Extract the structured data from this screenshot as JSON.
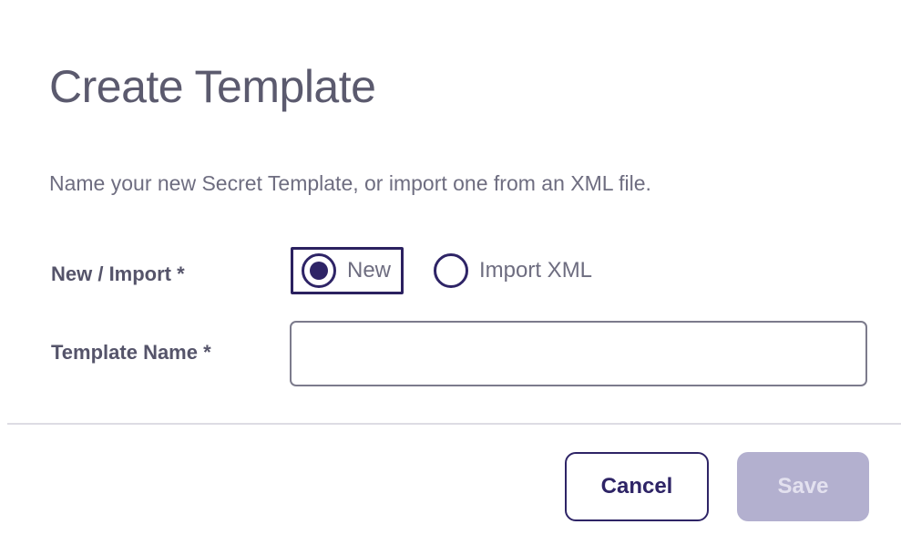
{
  "dialog": {
    "title": "Create Template",
    "subtitle": "Name your new Secret Template, or import one from an XML file."
  },
  "form": {
    "new_import_label": "New / Import *",
    "options": [
      {
        "label": "New",
        "selected": true
      },
      {
        "label": "Import XML",
        "selected": false
      }
    ],
    "template_name_label": "Template Name *",
    "template_name_value": ""
  },
  "footer": {
    "cancel_label": "Cancel",
    "save_label": "Save",
    "save_disabled": true
  },
  "colors": {
    "accent": "#2e2466",
    "save_disabled_bg": "#b3b0cf",
    "text_muted": "#6e6d80"
  }
}
